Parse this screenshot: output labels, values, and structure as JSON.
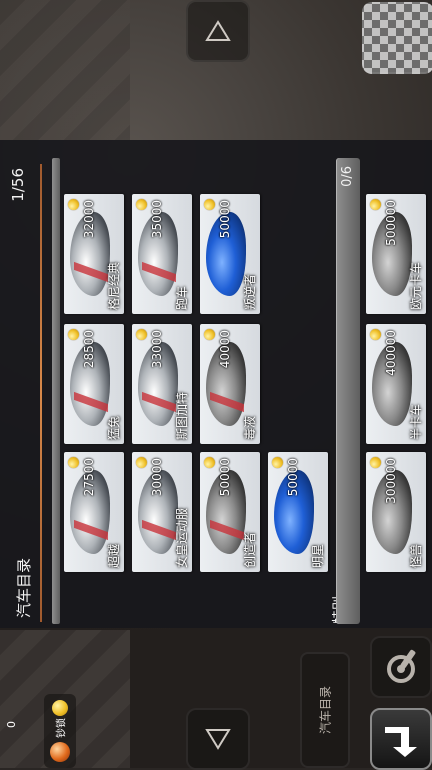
{
  "catalog": {
    "title": "汽车目录",
    "count": "1/56",
    "cars": [
      {
        "name": "超越",
        "price": "27500",
        "color": "silver"
      },
      {
        "name": "猛兔",
        "price": "28500",
        "color": "silver"
      },
      {
        "name": "格尼经典",
        "price": "32000",
        "color": "silver"
      },
      {
        "name": "女皇运动服",
        "price": "30000",
        "color": "silver"
      },
      {
        "name": "斯图加特",
        "price": "33000",
        "color": "silver"
      },
      {
        "name": "跑车",
        "price": "35000",
        "color": "silver"
      },
      {
        "name": "创造者",
        "price": "50000",
        "color": "gray"
      },
      {
        "name": "毒液",
        "price": "40000",
        "color": "gray"
      },
      {
        "name": "叛逆者",
        "price": "50000",
        "color": "blue"
      },
      {
        "name": "明星",
        "price": "50000",
        "color": "blue"
      }
    ]
  },
  "special": {
    "label": "特别",
    "count": "0/6",
    "cars": [
      {
        "name": "怪兽",
        "price": "300000",
        "color": "gray"
      },
      {
        "name": "半卡车",
        "price": "400000",
        "color": "gray"
      },
      {
        "name": "欧元卡车",
        "price": "500000",
        "color": "gray"
      }
    ]
  },
  "hud": {
    "tab_label": "汽车目录",
    "coin_label": "钞锁",
    "coin_value": "0"
  },
  "colors": {
    "coin": "#f0c028",
    "accent": "#d8894a"
  }
}
